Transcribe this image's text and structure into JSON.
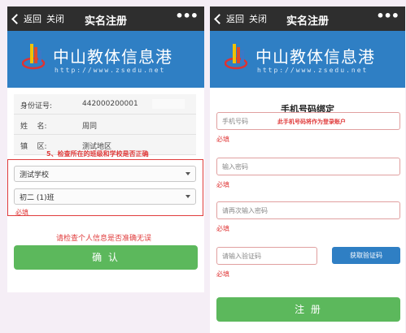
{
  "left": {
    "back_label": "返回",
    "close_label": "关闭",
    "title": "实名注册",
    "more": "•••",
    "brand": "中山教体信息港",
    "url": "http://www.zsedu.net",
    "info_rows": [
      {
        "label": "身份证号:",
        "value": "442000200001"
      },
      {
        "label": "姓    名:",
        "value": "周同"
      },
      {
        "label": "镇    区:",
        "value": "测试地区"
      }
    ],
    "annotation_check_class": "5、检查所在的班级和学校是否正确",
    "school_select": "测试学校",
    "class_select": "初二 (1)班",
    "required_label": "必填",
    "annotation_check_info": "请检查个人信息是否准确无误",
    "confirm_button": "确 认"
  },
  "right": {
    "back_label": "返回",
    "close_label": "关闭",
    "title": "实名注册",
    "more": "•••",
    "brand": "中山教体信息港",
    "url": "http://www.zsedu.net",
    "section_title": "手机号码绑定",
    "phone_placeholder": "手机号码",
    "phone_note": "此手机号码将作为登录账户",
    "required_label": "必填",
    "password_placeholder": "输入密码",
    "password2_placeholder": "请再次输入密码",
    "code_placeholder": "请输入验证码",
    "get_code_button": "获取验证码",
    "register_button": "注 册"
  },
  "colors": {
    "title_bar": "#2e2e2e",
    "banner": "#2f7fc4",
    "accent_green": "#5cb85c",
    "accent_blue": "#2f7fc4",
    "annotation_red": "#e03c3c"
  }
}
